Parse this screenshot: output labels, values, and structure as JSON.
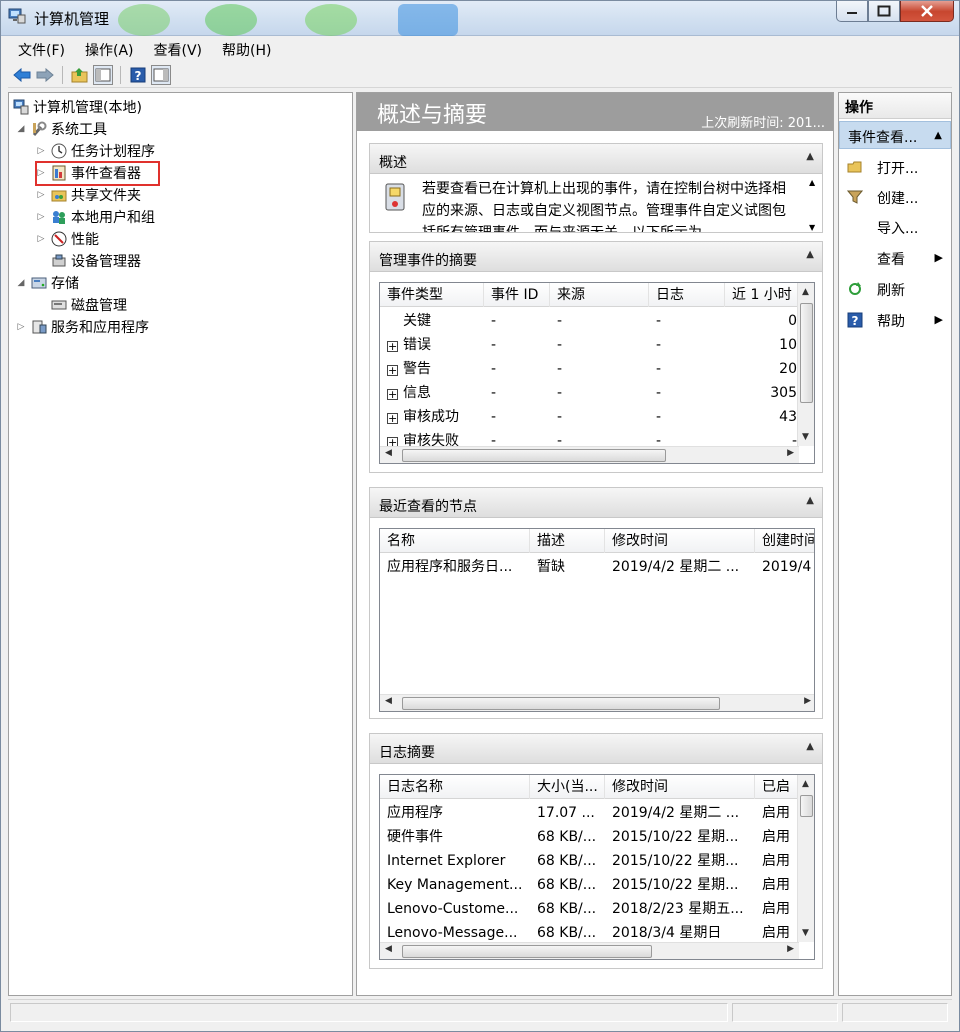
{
  "window": {
    "title": "计算机管理"
  },
  "menu": [
    "文件(F)",
    "操作(A)",
    "查看(V)",
    "帮助(H)"
  ],
  "tree": [
    {
      "label": "计算机管理(本地)",
      "arrow": "",
      "icon": "computer-management-icon"
    },
    {
      "label": "系统工具",
      "arrow": "◢",
      "icon": "tools-icon"
    },
    {
      "label": "任务计划程序",
      "arrow": "▷",
      "icon": "clock-icon"
    },
    {
      "label": "事件查看器",
      "arrow": "▷",
      "icon": "event-viewer-icon"
    },
    {
      "label": "共享文件夹",
      "arrow": "▷",
      "icon": "shared-folder-icon"
    },
    {
      "label": "本地用户和组",
      "arrow": "▷",
      "icon": "users-icon"
    },
    {
      "label": "性能",
      "arrow": "▷",
      "icon": "performance-icon"
    },
    {
      "label": "设备管理器",
      "arrow": "",
      "icon": "device-manager-icon"
    },
    {
      "label": "存储",
      "arrow": "◢",
      "icon": "storage-icon"
    },
    {
      "label": "磁盘管理",
      "arrow": "",
      "icon": "disk-icon"
    },
    {
      "label": "服务和应用程序",
      "arrow": "▷",
      "icon": "services-icon"
    }
  ],
  "main": {
    "title": "概述与摘要",
    "subtitle": "上次刷新时间: 201...",
    "overview": {
      "header": "概述",
      "text": "若要查看已在计算机上出现的事件，请在控制台树中选择相应的来源、日志或自定义视图节点。管理事件自定义试图包括所有管理事件，而与来源无关。以下所示为..."
    },
    "admin_summary": {
      "header": "管理事件的摘要",
      "columns": [
        "事件类型",
        "事件 ID",
        "来源",
        "日志",
        "近 1 小时"
      ],
      "rows": [
        {
          "expand": false,
          "type": "关键",
          "id": "-",
          "source": "-",
          "log": "-",
          "hour": "0"
        },
        {
          "expand": true,
          "type": "错误",
          "id": "-",
          "source": "-",
          "log": "-",
          "hour": "10"
        },
        {
          "expand": true,
          "type": "警告",
          "id": "-",
          "source": "-",
          "log": "-",
          "hour": "20"
        },
        {
          "expand": true,
          "type": "信息",
          "id": "-",
          "source": "-",
          "log": "-",
          "hour": "305"
        },
        {
          "expand": true,
          "type": "审核成功",
          "id": "-",
          "source": "-",
          "log": "-",
          "hour": "43"
        },
        {
          "expand": true,
          "type": "审核失败",
          "id": "-",
          "source": "-",
          "log": "-",
          "hour": "-"
        }
      ]
    },
    "recent": {
      "header": "最近查看的节点",
      "columns": [
        "名称",
        "描述",
        "修改时间",
        "创建时间"
      ],
      "rows": [
        {
          "name": "应用程序和服务日...",
          "desc": "暂缺",
          "modified": "2019/4/2 星期二 ...",
          "created": "2019/4"
        }
      ]
    },
    "log_summary": {
      "header": "日志摘要",
      "columns": [
        "日志名称",
        "大小(当...",
        "修改时间",
        "已启"
      ],
      "rows": [
        {
          "name": "应用程序",
          "size": "17.07 ...",
          "modified": "2019/4/2 星期二 ...",
          "enabled": "启用"
        },
        {
          "name": "硬件事件",
          "size": "68 KB/...",
          "modified": "2015/10/22 星期...",
          "enabled": "启用"
        },
        {
          "name": "Internet Explorer",
          "size": "68 KB/...",
          "modified": "2015/10/22 星期...",
          "enabled": "启用"
        },
        {
          "name": "Key Management...",
          "size": "68 KB/...",
          "modified": "2015/10/22 星期...",
          "enabled": "启用"
        },
        {
          "name": "Lenovo-Custome...",
          "size": "68 KB/...",
          "modified": "2018/2/23 星期五...",
          "enabled": "启用"
        },
        {
          "name": "Lenovo-Message...",
          "size": "68 KB/...",
          "modified": "2018/3/4 星期日",
          "enabled": "启用"
        }
      ]
    }
  },
  "actions": {
    "title": "操作",
    "group": "事件查看...",
    "items": [
      {
        "label": "打开...",
        "icon": "open-folder-icon",
        "submenu": false
      },
      {
        "label": "创建...",
        "icon": "filter-icon",
        "submenu": false
      },
      {
        "label": "导入...",
        "icon": "",
        "submenu": false
      },
      {
        "label": "查看",
        "icon": "",
        "submenu": true
      },
      {
        "label": "刷新",
        "icon": "refresh-icon",
        "submenu": false
      },
      {
        "label": "帮助",
        "icon": "help-icon",
        "submenu": true
      }
    ]
  }
}
